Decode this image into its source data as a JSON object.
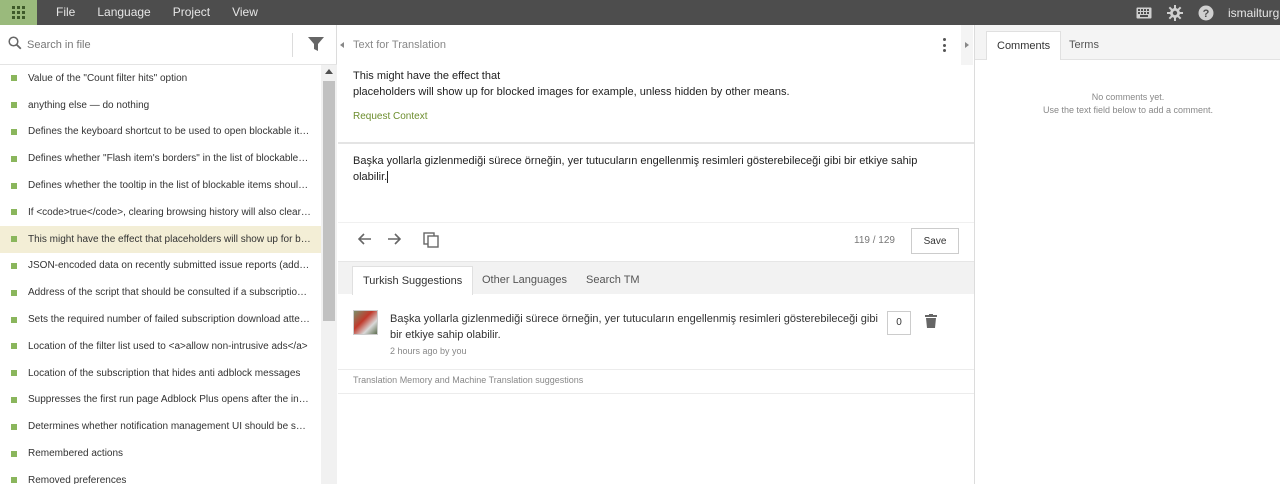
{
  "topbar": {
    "menu": [
      "File",
      "Language",
      "Project",
      "View"
    ],
    "username": "ismailturgut",
    "icons": [
      "apps-grid-icon",
      "keyboard-icon",
      "gear-icon",
      "help-icon"
    ],
    "accent": "#9aba7c",
    "bar_color": "#4d4d4d"
  },
  "sidebar": {
    "search_placeholder": "Search in file",
    "items": [
      {
        "label": "Value of the \"Count filter hits\" option"
      },
      {
        "label": "anything else — do nothing"
      },
      {
        "label": "Defines the keyboard shortcut to be used to open blockable items"
      },
      {
        "label": "Defines whether \"Flash item's borders\" in the list of blockable items"
      },
      {
        "label": "Defines whether the tooltip in the list of blockable items should be shown"
      },
      {
        "label": "If <code>true</code>, clearing browsing history will also clear filter hit statistics"
      },
      {
        "label": "This might have the effect that placeholders will show up for blocked images"
      },
      {
        "label": "JSON-encoded data on recently submitted issue reports (address of the page)"
      },
      {
        "label": "Address of the script that should be consulted if a subscription is invalid"
      },
      {
        "label": "Sets the required number of failed subscription download attempts"
      },
      {
        "label": "Location of the filter list used to <a>allow non-intrusive ads</a>"
      },
      {
        "label": "Location of the subscription that hides anti adblock messages"
      },
      {
        "label": "Suppresses the first run page Adblock Plus opens after the installation"
      },
      {
        "label": "Determines whether notification management UI should be shown"
      },
      {
        "label": "Remembered actions"
      },
      {
        "label": "Removed preferences"
      }
    ],
    "selected_index": 6,
    "status_color": "#8ab65c"
  },
  "editor": {
    "source_title": "Text for Translation",
    "source_line1": "This might have the effect that",
    "source_line2": "placeholders will show up for blocked images for example, unless hidden by other means.",
    "request_context": "Request Context",
    "target_text": "Başka yollarla gizlenmediği sürece örneğin, yer tutucuların engellenmiş resimleri gösterebileceği gibi bir etkiye sahip olabilir.",
    "char_count": "119 / 129",
    "save_label": "Save",
    "tabs": [
      "Turkish Suggestions",
      "Other Languages",
      "Search TM"
    ],
    "active_tab": 0,
    "suggestion": {
      "text": "Başka yollarla gizlenmediği sürece örneğin, yer tutucuların engellenmiş resimleri gösterebileceği gibi bir etkiye sahip olabilir.",
      "meta": "2 hours ago by you",
      "votes": "0"
    },
    "tm_label": "Translation Memory and Machine Translation suggestions"
  },
  "comments": {
    "tabs": [
      "Comments",
      "Terms"
    ],
    "active_tab": 0,
    "empty_line1": "No comments yet.",
    "empty_line2": "Use the text field below to add a comment."
  }
}
